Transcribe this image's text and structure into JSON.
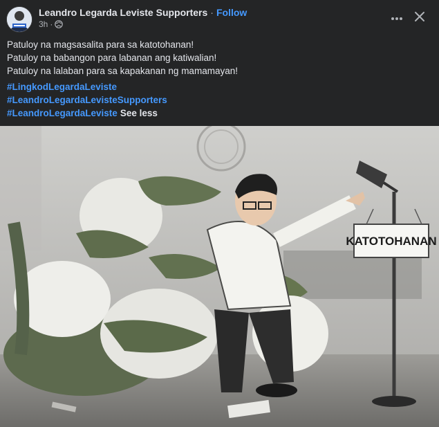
{
  "post": {
    "page_name": "Leandro Legarda Leviste Supporters",
    "separator": "·",
    "follow_label": "Follow",
    "time": "3h",
    "caption_lines": [
      "Patuloy na magsasalita para sa katotohanan!",
      "Patuloy na babangon para labanan ang katiwalian!",
      "Patuloy na lalaban para sa kapakanan ng mamamayan!"
    ],
    "hashtags": [
      "#LingkodLegardaLeviste",
      "#LeandroLegardaLevisteSupporters",
      "#LeandroLegardaLeviste"
    ],
    "see_less_label": "See less"
  },
  "image": {
    "sign_text": "KATOTOHANAN"
  },
  "icons": {
    "globe": "globe-icon",
    "more": "more-horizontal-icon",
    "close": "close-icon"
  },
  "colors": {
    "background": "#242526",
    "text": "#e4e6eb",
    "secondary_text": "#b0b3b8",
    "link": "#4599ff"
  }
}
